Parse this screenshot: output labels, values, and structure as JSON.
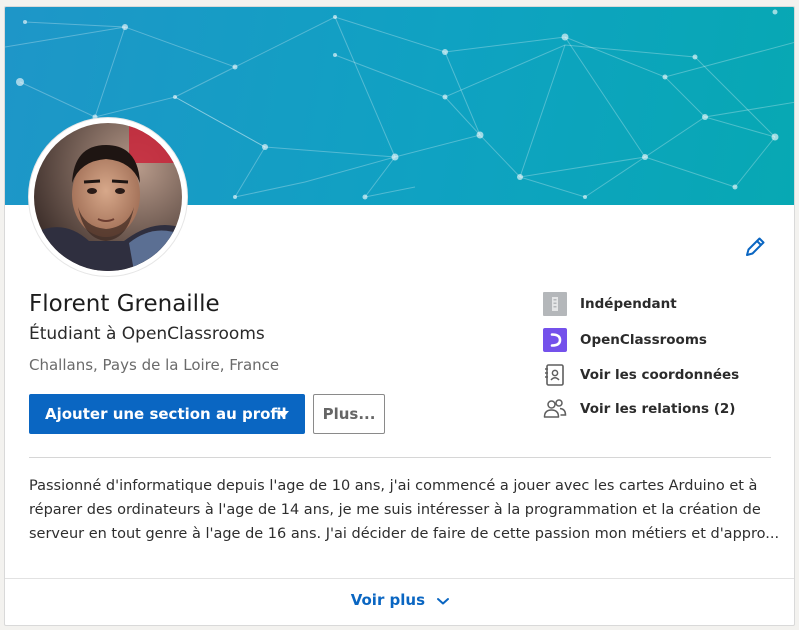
{
  "profile": {
    "name": "Florent Grenaille",
    "headline": "Étudiant à OpenClassrooms",
    "location": "Challans, Pays de la Loire, France"
  },
  "actions": {
    "add_section_label": "Ajouter une section au profil",
    "more_label": "Plus..."
  },
  "sidebar": {
    "items": [
      {
        "label": "Indépendant",
        "icon": "company-icon"
      },
      {
        "label": "OpenClassrooms",
        "icon": "openclassrooms-logo-icon"
      },
      {
        "label": "Voir les coordonnées",
        "icon": "contact-info-icon"
      },
      {
        "label": "Voir les relations (2)",
        "icon": "connections-icon"
      }
    ]
  },
  "summary": {
    "lines": [
      "Passionné d'informatique depuis l'age de 10 ans, j'ai commencé a jouer avec les cartes Arduino et à",
      "réparer des ordinateurs à l'age de 14 ans, je me suis intéresser à la programmation et la création de",
      "serveur en tout genre à l'age de 16 ans. J'ai décider de faire de cette passion mon métiers et d'appro..."
    ]
  },
  "footer": {
    "see_more_label": "Voir plus"
  },
  "colors": {
    "accent": "#0a66c2",
    "banner_start": "#1e96c8",
    "banner_end": "#07a8b3",
    "openclassrooms": "#7451eb"
  }
}
